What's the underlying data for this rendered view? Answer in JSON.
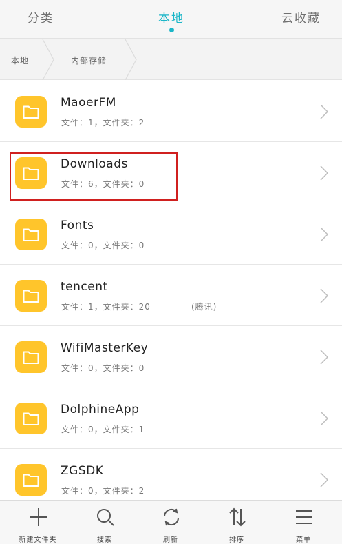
{
  "tabs": [
    {
      "label": "分类",
      "active": false
    },
    {
      "label": "本地",
      "active": true
    },
    {
      "label": "云收藏",
      "active": false
    }
  ],
  "breadcrumb": [
    "本地",
    "内部存储"
  ],
  "folders": [
    {
      "name": "MaoerFM",
      "meta": "文件：1，文件夹：2",
      "note": ""
    },
    {
      "name": "Downloads",
      "meta": "文件：6，文件夹：0",
      "note": ""
    },
    {
      "name": "Fonts",
      "meta": "文件：0，文件夹：0",
      "note": ""
    },
    {
      "name": "tencent",
      "meta": "文件：1，文件夹：20",
      "note": "(腾讯)"
    },
    {
      "name": "WifiMasterKey",
      "meta": "文件：0，文件夹：0",
      "note": ""
    },
    {
      "name": "DolphineApp",
      "meta": "文件：0，文件夹：1",
      "note": ""
    },
    {
      "name": "ZGSDK",
      "meta": "文件：0，文件夹：2",
      "note": ""
    }
  ],
  "toolbar": [
    {
      "label": "新建文件夹",
      "icon": "plus-icon"
    },
    {
      "label": "搜索",
      "icon": "search-icon"
    },
    {
      "label": "刷新",
      "icon": "refresh-icon"
    },
    {
      "label": "排序",
      "icon": "sort-icon"
    },
    {
      "label": "菜单",
      "icon": "menu-icon"
    }
  ],
  "colors": {
    "accent": "#1cb6c8",
    "folder": "#ffc52b",
    "highlight": "#d0201f"
  }
}
